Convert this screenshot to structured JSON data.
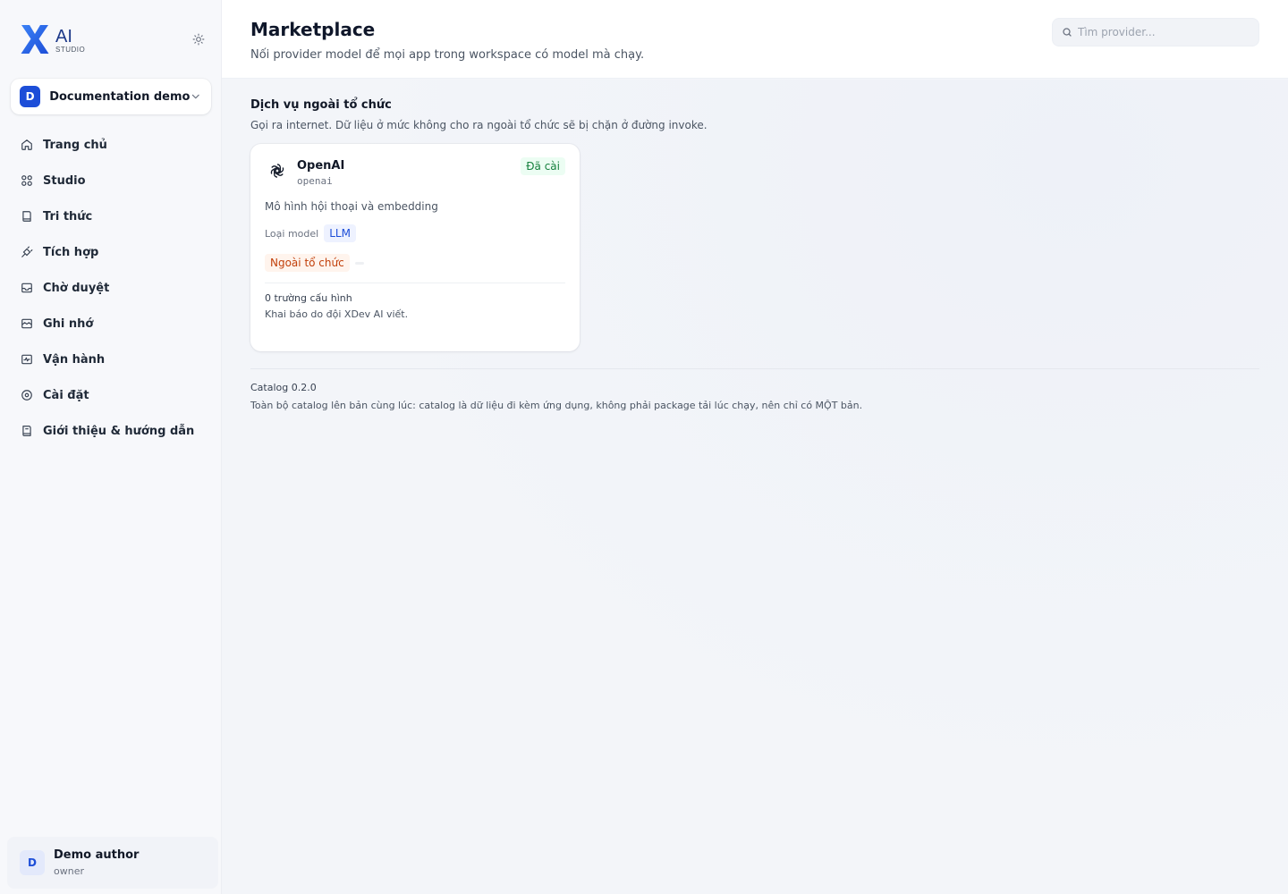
{
  "brand": {
    "mark": "X",
    "name": "AI",
    "sub": "STUDIO",
    "accent": "#1d6df2"
  },
  "workspace": {
    "initial": "D",
    "name": "Documentation demo"
  },
  "nav": {
    "items": [
      {
        "label": "Trang chủ",
        "icon": "home-icon"
      },
      {
        "label": "Studio",
        "icon": "grid-icon"
      },
      {
        "label": "Tri thức",
        "icon": "book-icon"
      },
      {
        "label": "Tích hợp",
        "icon": "plug-icon"
      },
      {
        "label": "Chờ duyệt",
        "icon": "inbox-icon"
      },
      {
        "label": "Ghi nhớ",
        "icon": "memory-icon"
      },
      {
        "label": "Vận hành",
        "icon": "activity-icon"
      },
      {
        "label": "Cài đặt",
        "icon": "settings-icon"
      },
      {
        "label": "Giới thiệu & hướng dẫn",
        "icon": "guide-icon"
      }
    ]
  },
  "user": {
    "initial": "D",
    "name": "Demo author",
    "role": "owner"
  },
  "header": {
    "title": "Marketplace",
    "subtitle": "Nối provider model để mọi app trong workspace có model mà chạy.",
    "search_placeholder": "Tìm provider..."
  },
  "section": {
    "title": "Dịch vụ ngoài tổ chức",
    "description": "Gọi ra internet. Dữ liệu ở mức không cho ra ngoài tổ chức sẽ bị chặn ở đường invoke."
  },
  "provider": {
    "name": "OpenAI",
    "id": "openai",
    "status": "Đã cài",
    "description": "Mô hình hội thoại và embedding",
    "model_type_label": "Loại model",
    "model_type": "LLM",
    "scope": "Ngoài tổ chức",
    "config_count": "0 trường cấu hình",
    "config_note": "Khai báo do đội XDev AI viết."
  },
  "catalog": {
    "version": "Catalog 0.2.0",
    "note": "Toàn bộ catalog lên bản cùng lúc: catalog là dữ liệu đi kèm ứng dụng, không phải package tải lúc chạy, nên chỉ có MỘT bản."
  }
}
